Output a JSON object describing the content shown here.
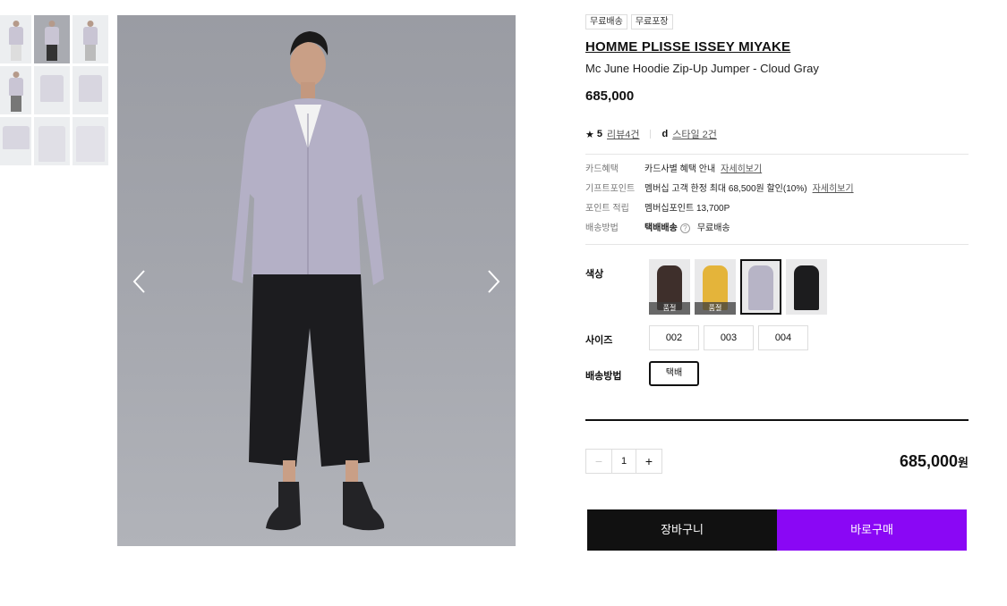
{
  "thumbnails": [
    {
      "kind": "model"
    },
    {
      "kind": "model-dark"
    },
    {
      "kind": "model"
    },
    {
      "kind": "model"
    },
    {
      "kind": "flat"
    },
    {
      "kind": "flat"
    },
    {
      "kind": "flat"
    },
    {
      "kind": "flat"
    },
    {
      "kind": "flat"
    }
  ],
  "product": {
    "tags": [
      "무료배송",
      "무료포장"
    ],
    "brand": "HOMME PLISSE ISSEY MIYAKE",
    "name": "Mc June Hoodie Zip-Up Jumper - Cloud Gray",
    "price": "685,000",
    "rating": {
      "star": "★",
      "value": "5",
      "reviews": "리뷰4건"
    },
    "style": {
      "icon": "d",
      "label": "스타일 2건"
    }
  },
  "info": {
    "card": {
      "label": "카드혜택",
      "value": "카드사별 혜택 안내",
      "link": "자세히보기"
    },
    "gift": {
      "label": "기프트포인트",
      "value": "멤버십 고객 한정 최대 68,500원 할인(10%)",
      "link": "자세히보기"
    },
    "point": {
      "label": "포인트 적립",
      "value": "멤버십포인트 13,700P"
    },
    "ship": {
      "label": "배송방법",
      "value": "택배배송",
      "help": "?",
      "extra": "무료배송"
    }
  },
  "options": {
    "color_label": "색상",
    "colors": [
      {
        "hex": "#3e2f2b",
        "sold": "품절"
      },
      {
        "hex": "#e4b43a",
        "sold": "품절"
      },
      {
        "hex": "#b7b4c6",
        "sold": ""
      },
      {
        "hex": "#1c1c1e",
        "sold": ""
      }
    ],
    "size_label": "사이즈",
    "sizes": [
      "002",
      "003",
      "004"
    ],
    "shipping_label": "배송방법",
    "shipping_option": "택배"
  },
  "order": {
    "minus": "−",
    "quantity": "1",
    "plus": "+",
    "total": "685,000",
    "currency": "원"
  },
  "buttons": {
    "cart": "장바구니",
    "buy": "바로구매"
  },
  "colors": {
    "buy": "#8a07f5",
    "cart": "#111111"
  }
}
